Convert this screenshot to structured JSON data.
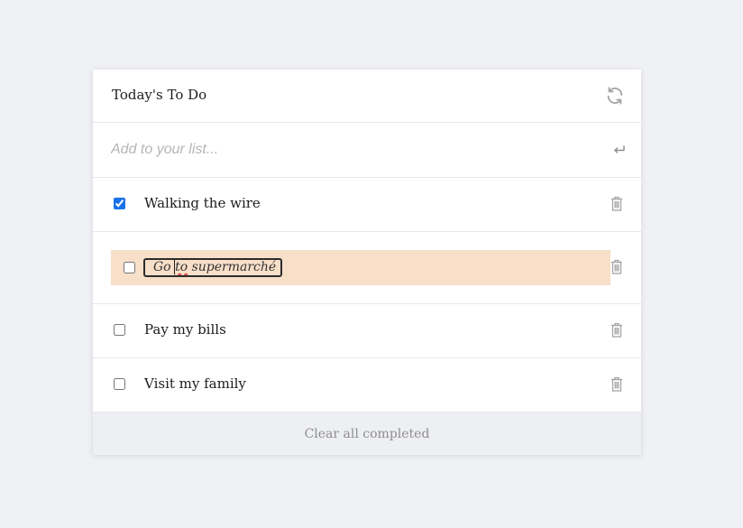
{
  "header": {
    "title": "Today's To Do",
    "refresh_icon": "refresh-icon"
  },
  "add": {
    "placeholder": "Add to your list...",
    "enter_icon": "enter-return-icon"
  },
  "todos": [
    {
      "label": "Walking the wire",
      "checked": true
    },
    {
      "label": "Go to supermarché",
      "checked": false,
      "editing": true
    },
    {
      "label": "Pay my bills",
      "checked": false
    },
    {
      "label": "Visit my family",
      "checked": false
    }
  ],
  "footer": {
    "clear_label": "Clear all completed"
  },
  "colors": {
    "accent": "#1a73e8",
    "editing_bg": "#f8dfc8",
    "icon": "#a5a5a8"
  }
}
